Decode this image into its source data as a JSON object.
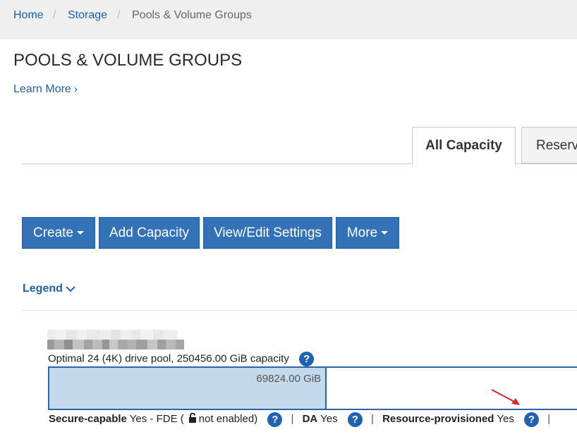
{
  "breadcrumb": {
    "home": "Home",
    "storage": "Storage",
    "current": "Pools & Volume Groups",
    "separator": "/"
  },
  "page": {
    "title": "POOLS & VOLUME GROUPS",
    "learn_more": "Learn More",
    "learn_more_chevron": "›"
  },
  "tabs": {
    "all_capacity": "All Capacity",
    "reserved": "Reserv"
  },
  "toolbar": {
    "create": "Create",
    "add_capacity": "Add Capacity",
    "view_edit_settings": "View/Edit Settings",
    "more": "More"
  },
  "legend": {
    "label": "Legend",
    "icon": "chevron-down-icon"
  },
  "pool": {
    "description": "Optimal 24 (4K) drive pool, 250456.00 GiB capacity",
    "used_capacity": "69824.00 GiB",
    "used_fraction": 0.52,
    "secure_label": "Secure-capable",
    "secure_value": "Yes - FDE (",
    "lock_icon": "unlock-icon",
    "secure_suffix": "not enabled)",
    "da_label": "DA",
    "da_value": "Yes",
    "resource_label": "Resource-provisioned",
    "resource_value": "Yes",
    "divider": "|"
  },
  "help": {
    "glyph": "?"
  },
  "colors": {
    "button": "#3372b6",
    "link": "#1f5fa5",
    "bar_border": "#2b65a8",
    "bar_fill": "#c3d9ec",
    "annotation_arrow": "#d9232e"
  }
}
